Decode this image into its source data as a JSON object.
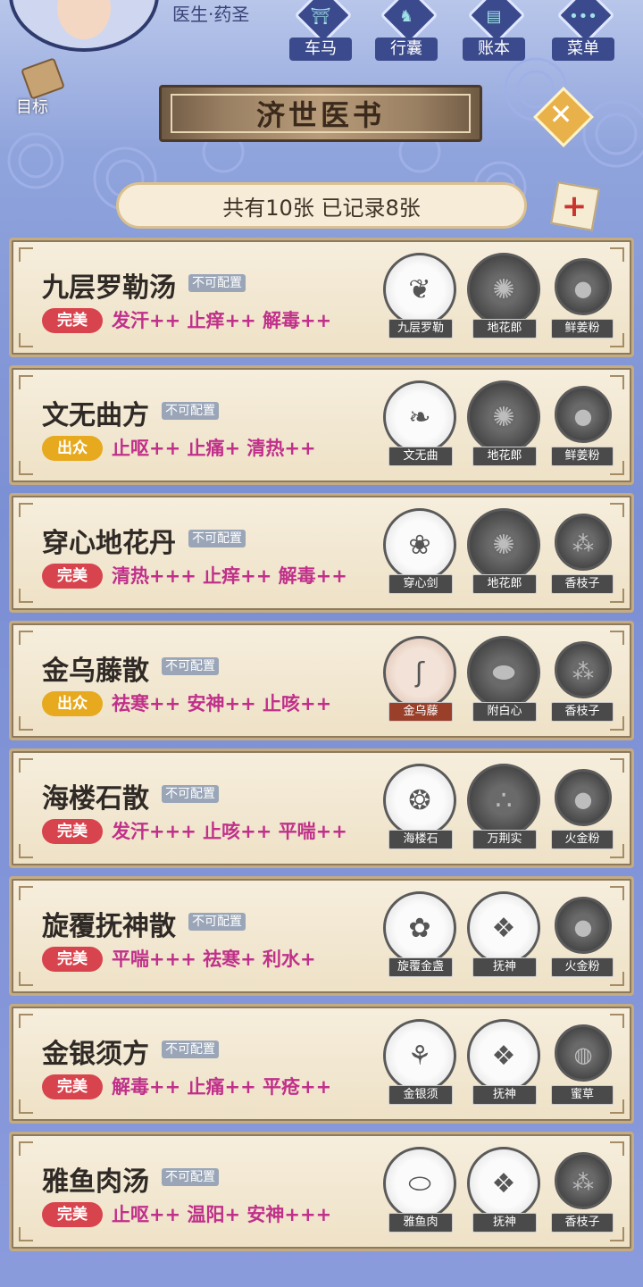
{
  "header": {
    "role": "医生·药圣",
    "buttons": [
      {
        "label": "车马",
        "icon": "carriage-icon",
        "glyph": "⛩"
      },
      {
        "label": "行囊",
        "icon": "bag-icon",
        "glyph": "♞"
      },
      {
        "label": "账本",
        "icon": "ledger-icon",
        "glyph": "▤"
      },
      {
        "label": "菜单",
        "icon": "menu-dots-icon",
        "glyph": "•••"
      }
    ],
    "goal_label": "目标"
  },
  "title": "济世医书",
  "close_glyph": "✕",
  "count_text": "共有10张 已记录8张",
  "add_glyph": "+",
  "prescriptions": [
    {
      "name": "九层罗勒汤",
      "config": "不可配置",
      "quality": "完美",
      "quality_type": "perfect",
      "effects": "发汗++ 止痒++ 解毒++",
      "ingredients": [
        "九层罗勒",
        "地花郎",
        "鲜姜粉"
      ]
    },
    {
      "name": "文无曲方",
      "config": "不可配置",
      "quality": "出众",
      "quality_type": "excellent",
      "effects": "止呕++ 止痛+ 清热++",
      "ingredients": [
        "文无曲",
        "地花郎",
        "鲜姜粉"
      ]
    },
    {
      "name": "穿心地花丹",
      "config": "不可配置",
      "quality": "完美",
      "quality_type": "perfect",
      "effects": "清热+++ 止痒++ 解毒++",
      "ingredients": [
        "穿心剑",
        "地花郎",
        "香枝子"
      ]
    },
    {
      "name": "金乌藤散",
      "config": "不可配置",
      "quality": "出众",
      "quality_type": "excellent",
      "effects": "祛寒++ 安神++ 止咳++",
      "ingredients": [
        "金乌藤",
        "附白心",
        "香枝子"
      ]
    },
    {
      "name": "海楼石散",
      "config": "不可配置",
      "quality": "完美",
      "quality_type": "perfect",
      "effects": "发汗+++ 止咳++ 平喘++",
      "ingredients": [
        "海楼石",
        "万荆实",
        "火金粉"
      ]
    },
    {
      "name": "旋覆抚神散",
      "config": "不可配置",
      "quality": "完美",
      "quality_type": "perfect",
      "effects": "平喘+++ 祛寒+ 利水+",
      "ingredients": [
        "旋覆金盏",
        "抚神",
        "火金粉"
      ]
    },
    {
      "name": "金银须方",
      "config": "不可配置",
      "quality": "完美",
      "quality_type": "perfect",
      "effects": "解毒++ 止痛++ 平疮++",
      "ingredients": [
        "金银须",
        "抚神",
        "蜜草"
      ]
    },
    {
      "name": "雅鱼肉汤",
      "config": "不可配置",
      "quality": "完美",
      "quality_type": "perfect",
      "effects": "止呕++ 温阳+ 安神+++",
      "ingredients": [
        "雅鱼肉",
        "抚神",
        "香枝子"
      ]
    }
  ],
  "colors": {
    "perfect": "#d8444d",
    "excellent": "#e7a91e",
    "effect_text": "#c0308a"
  }
}
